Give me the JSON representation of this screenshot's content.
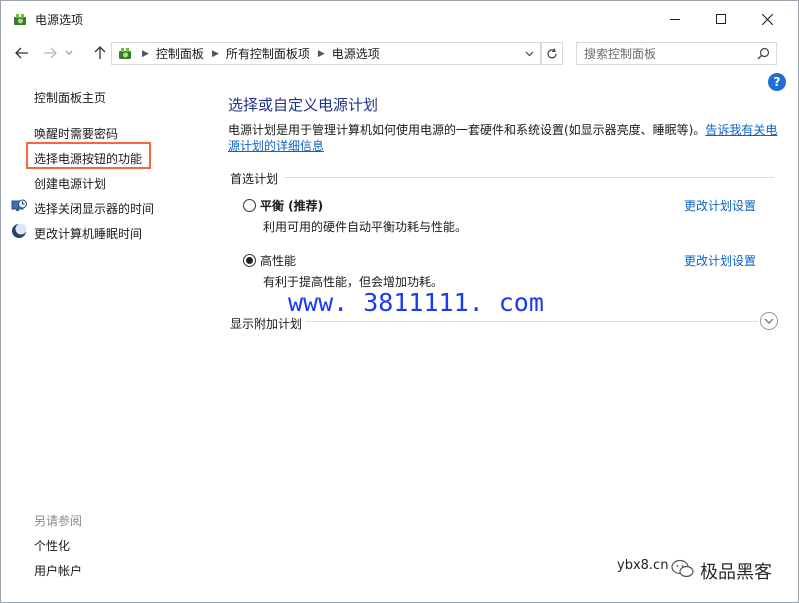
{
  "window": {
    "title": "电源选项"
  },
  "address_bar": {
    "crumbs": [
      "控制面板",
      "所有控制面板项",
      "电源选项"
    ]
  },
  "search": {
    "placeholder": "搜索控制面板"
  },
  "sidebar": {
    "home": "控制面板主页",
    "items": [
      "唤醒时需要密码",
      "选择电源按钮的功能",
      "创建电源计划",
      "选择关闭显示器的时间",
      "更改计算机睡眠时间"
    ],
    "see_also_title": "另请参阅",
    "see_also": [
      "个性化",
      "用户帐户"
    ]
  },
  "main": {
    "title": "选择或自定义电源计划",
    "description": "电源计划是用于管理计算机如何使用电源的一套硬件和系统设置(如显示器亮度、睡眠等)。",
    "description_link": "告诉我有关电源计划的详细信息",
    "preferred_label": "首选计划",
    "plans": [
      {
        "name": "平衡 (推荐)",
        "description": "利用可用的硬件自动平衡功耗与性能。",
        "change_link": "更改计划设置",
        "selected": false
      },
      {
        "name": "高性能",
        "description": "有利于提高性能，但会增加功耗。",
        "change_link": "更改计划设置",
        "selected": true
      }
    ],
    "show_more": "显示附加计划"
  },
  "watermark": "www. 3811111. com",
  "corner_watermark": {
    "site": "ybx8.cn",
    "brand": "极品黑客"
  },
  "colors": {
    "accent_link": "#0b62c8",
    "title": "#1e3287",
    "highlight": "#f26a3a",
    "watermark": "#1a3cf0"
  }
}
